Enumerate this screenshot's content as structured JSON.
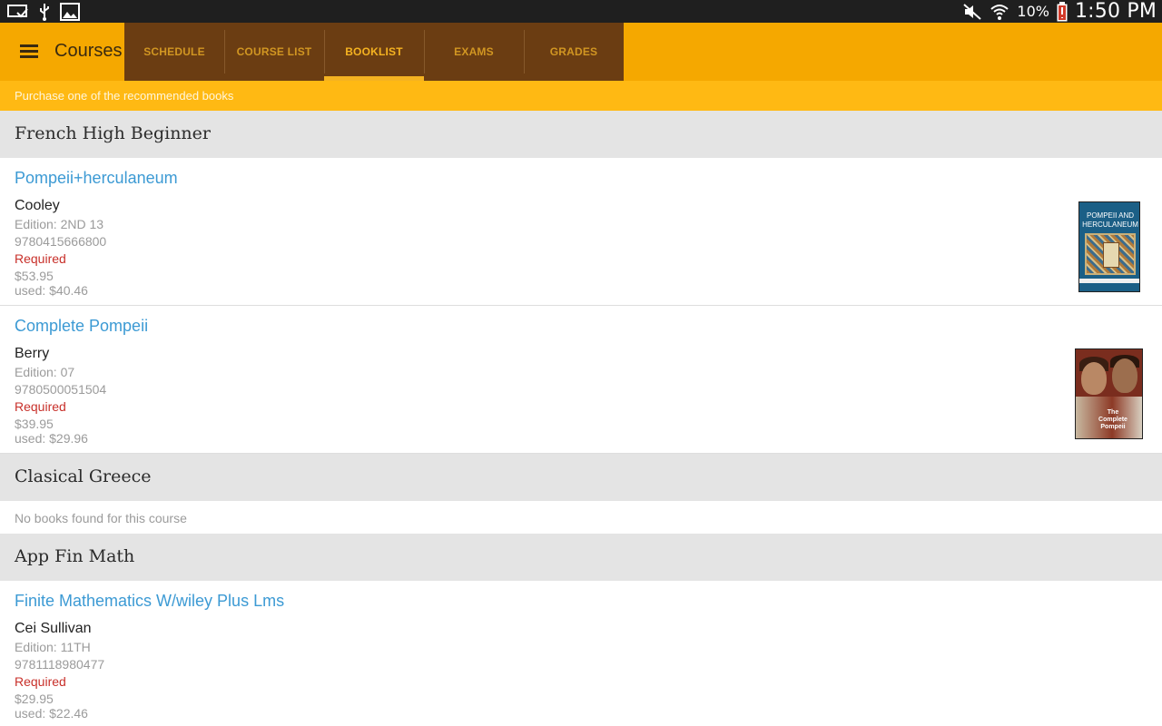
{
  "status_bar": {
    "icons_left": [
      "cast-screen-icon",
      "usb-icon",
      "gallery-icon"
    ],
    "icons_right": [
      "mute-icon",
      "wifi-icon",
      "battery-low-icon"
    ],
    "battery": "10%",
    "time": "1:50 PM"
  },
  "app_bar": {
    "title": "Courses",
    "tabs": [
      {
        "label": "SCHEDULE",
        "active": false
      },
      {
        "label": "COURSE LIST",
        "active": false
      },
      {
        "label": "BOOKLIST",
        "active": true
      },
      {
        "label": "EXAMS",
        "active": false
      },
      {
        "label": "GRADES",
        "active": false
      }
    ]
  },
  "subheader": "Purchase one of the recommended books",
  "courses": [
    {
      "name": "French High Beginner",
      "books": [
        {
          "title": "Pompeii+herculaneum",
          "author": "Cooley",
          "edition": "Edition: 2ND 13",
          "isbn": "9780415666800",
          "status": "Required",
          "price_new": "$53.95",
          "price_used": "used: $40.46",
          "cover_text": "POMPEII AND HERCULANEUM"
        },
        {
          "title": "Complete Pompeii",
          "author": "Berry",
          "edition": "Edition: 07",
          "isbn": "9780500051504",
          "status": "Required",
          "price_new": "$39.95",
          "price_used": "used: $29.96",
          "cover_text": "The Complete Pompeii"
        }
      ]
    },
    {
      "name": "Clasical Greece",
      "no_books": "No books found for this course"
    },
    {
      "name": "App Fin Math",
      "books": [
        {
          "title": "Finite Mathematics W/wiley Plus Lms",
          "author": "Cei Sullivan",
          "edition": "Edition: 11TH",
          "isbn": "9781118980477",
          "status": "Required",
          "price_new": "$29.95",
          "price_used": "used: $22.46"
        }
      ]
    }
  ],
  "colors": {
    "app_bar": "#f5a800",
    "tab_strip": "#6b3d12",
    "active_tab": "#f5b321",
    "link": "#3c9ad4",
    "required": "#c8302a"
  }
}
